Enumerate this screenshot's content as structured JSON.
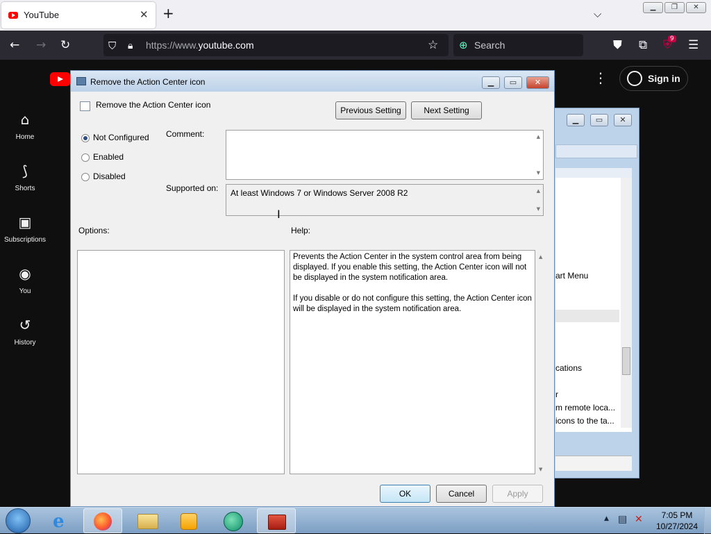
{
  "browser": {
    "tab_title": "YouTube",
    "url_scheme": "https://www.",
    "url_host": "youtube.com",
    "search_placeholder": "Search",
    "extension_badge": "9",
    "icons": [
      "back-icon",
      "forward-icon",
      "reload-icon",
      "shield-icon",
      "lock-icon",
      "star-icon",
      "pocket-icon",
      "extensions-icon",
      "menu-icon"
    ]
  },
  "youtube": {
    "nav": [
      {
        "label": "Home",
        "icon": "home-icon"
      },
      {
        "label": "Shorts",
        "icon": "shorts-icon"
      },
      {
        "label": "Subscriptions",
        "icon": "subscriptions-icon"
      },
      {
        "label": "You",
        "icon": "you-icon"
      },
      {
        "label": "History",
        "icon": "history-icon"
      }
    ],
    "sign_in": "Sign in"
  },
  "background_window": {
    "lines": [
      "art Menu",
      "cations",
      "r",
      "m remote loca...",
      "icons to the ta..."
    ]
  },
  "dialog": {
    "title": "Remove the Action Center icon",
    "setting_name": "Remove the Action Center icon",
    "prev_button": "Previous Setting",
    "next_button": "Next Setting",
    "radios": [
      {
        "label": "Not Configured",
        "checked": true
      },
      {
        "label": "Enabled",
        "checked": false
      },
      {
        "label": "Disabled",
        "checked": false
      }
    ],
    "comment_label": "Comment:",
    "comment_value": "",
    "supported_label": "Supported on:",
    "supported_value": "At least Windows 7 or Windows Server 2008 R2",
    "options_label": "Options:",
    "help_label": "Help:",
    "help_p1": " Prevents the Action Center in the system control area from being displayed. If you enable this setting, the Action Center icon will not be displayed in the system notification area.",
    "help_p2": "If you disable or do not configure this setting, the Action Center icon will be displayed in the system notification area.",
    "ok": "OK",
    "cancel": "Cancel",
    "apply": "Apply"
  },
  "taskbar": {
    "time": "7:05 PM",
    "date": "10/27/2024",
    "apps": [
      "start-orb-icon",
      "internet-explorer-icon",
      "firefox-icon",
      "file-explorer-icon",
      "media-player-icon",
      "network-globe-icon",
      "toolbox-icon"
    ]
  }
}
